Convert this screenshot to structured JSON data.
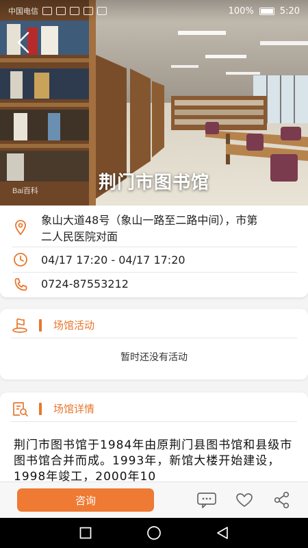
{
  "status_bar": {
    "carrier_text": "中国电信",
    "battery_percent": "100%",
    "time": "5:20"
  },
  "hero": {
    "title": "荆门市图书馆",
    "watermark": "Bai百科"
  },
  "info": {
    "address": "象山大道48号（象山一路至二路中间），市第二人民医院对面",
    "hours": "04/17 17:20 - 04/17 17:20",
    "phone": "0724-87553212"
  },
  "activities": {
    "title": "场馆活动",
    "empty_text": "暂时还没有活动"
  },
  "details": {
    "title": "场馆详情",
    "text": "荆门市图书馆于1984年由原荆门县图书馆和县级市图书馆合并而成。1993年，新馆大楼开始建设，1998年竣工，2000年10"
  },
  "actions": {
    "consult_label": "咨询"
  },
  "colors": {
    "accent": "#e8762c",
    "button": "#ee7a33"
  },
  "icons": {
    "back": "chevron-left-icon",
    "location": "location-pin-icon",
    "clock": "clock-icon",
    "phone": "phone-icon",
    "activity": "flag-icon",
    "details": "document-search-icon",
    "comment": "comment-icon",
    "favorite": "heart-icon",
    "share": "share-icon"
  }
}
